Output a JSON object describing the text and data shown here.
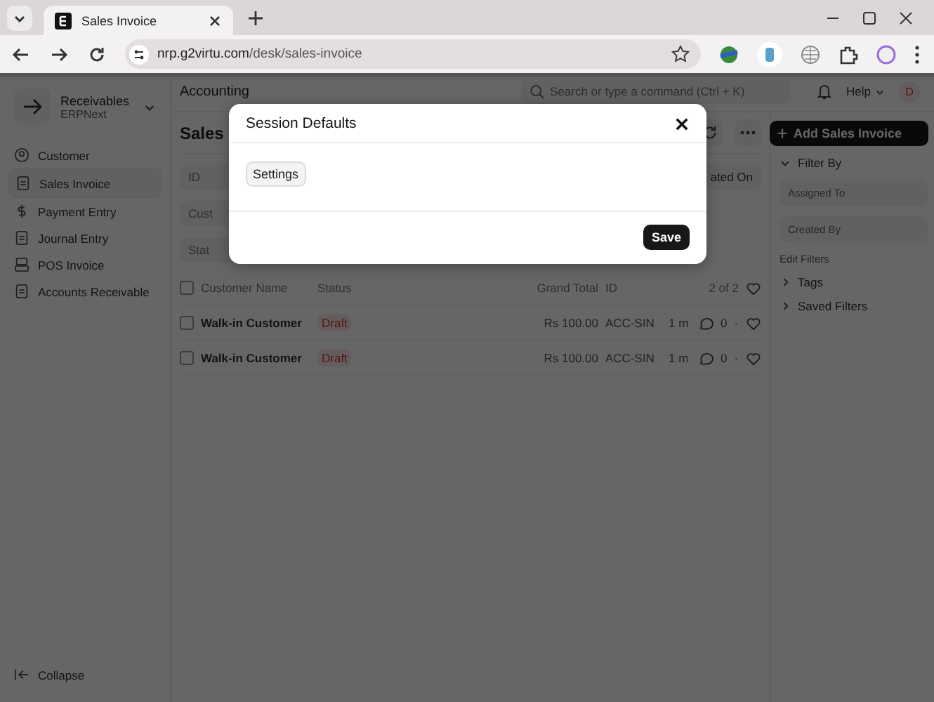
{
  "browser": {
    "tab_title": "Sales Invoice",
    "url_host": "nrp.g2virtu.com",
    "url_path": "/desk/sales-invoice"
  },
  "sidebar": {
    "title": "Receivables",
    "subtitle": "ERPNext",
    "items": [
      {
        "label": "Customer",
        "selected": false,
        "kind": "user"
      },
      {
        "label": "Sales Invoice",
        "selected": true,
        "kind": "invoice"
      },
      {
        "label": "Payment Entry",
        "selected": false,
        "kind": "dollar"
      },
      {
        "label": "Journal Entry",
        "selected": false,
        "kind": "doc"
      },
      {
        "label": "POS Invoice",
        "selected": false,
        "kind": "pos"
      },
      {
        "label": "Accounts Receivable",
        "selected": false,
        "kind": "doc"
      }
    ],
    "collapse": "Collapse"
  },
  "navbar": {
    "breadcrumb": "Accounting",
    "search_placeholder": "Search or type a command (Ctrl + K)",
    "help": "Help",
    "avatar": "D"
  },
  "page": {
    "title": "Sales",
    "primary_button": "Add Sales Invoice"
  },
  "list_filters": {
    "fields": [
      "ID",
      "Cust",
      "Stat"
    ],
    "sort": "ated On"
  },
  "table": {
    "select_all_checked": false,
    "columns": [
      "Customer Name",
      "Status",
      "Grand Total",
      "ID"
    ],
    "count": "2 of 2",
    "rows": [
      {
        "customer": "Walk-in Customer",
        "status": "Draft",
        "grand_total": "Rs 100.00",
        "id": "ACC-SIN",
        "age": "1 m",
        "comments": "0",
        "separator": "·",
        "checked": false
      },
      {
        "customer": "Walk-in Customer",
        "status": "Draft",
        "grand_total": "Rs 100.00",
        "id": "ACC-SIN",
        "age": "1 m",
        "comments": "0",
        "separator": "·",
        "checked": false
      }
    ]
  },
  "filter_panel": {
    "heading": "Filter By",
    "fields": [
      "Assigned To",
      "Created By"
    ],
    "edit": "Edit Filters",
    "sections": [
      "Tags",
      "Saved Filters"
    ]
  },
  "modal": {
    "title": "Session Defaults",
    "tag": "Settings",
    "save": "Save"
  }
}
